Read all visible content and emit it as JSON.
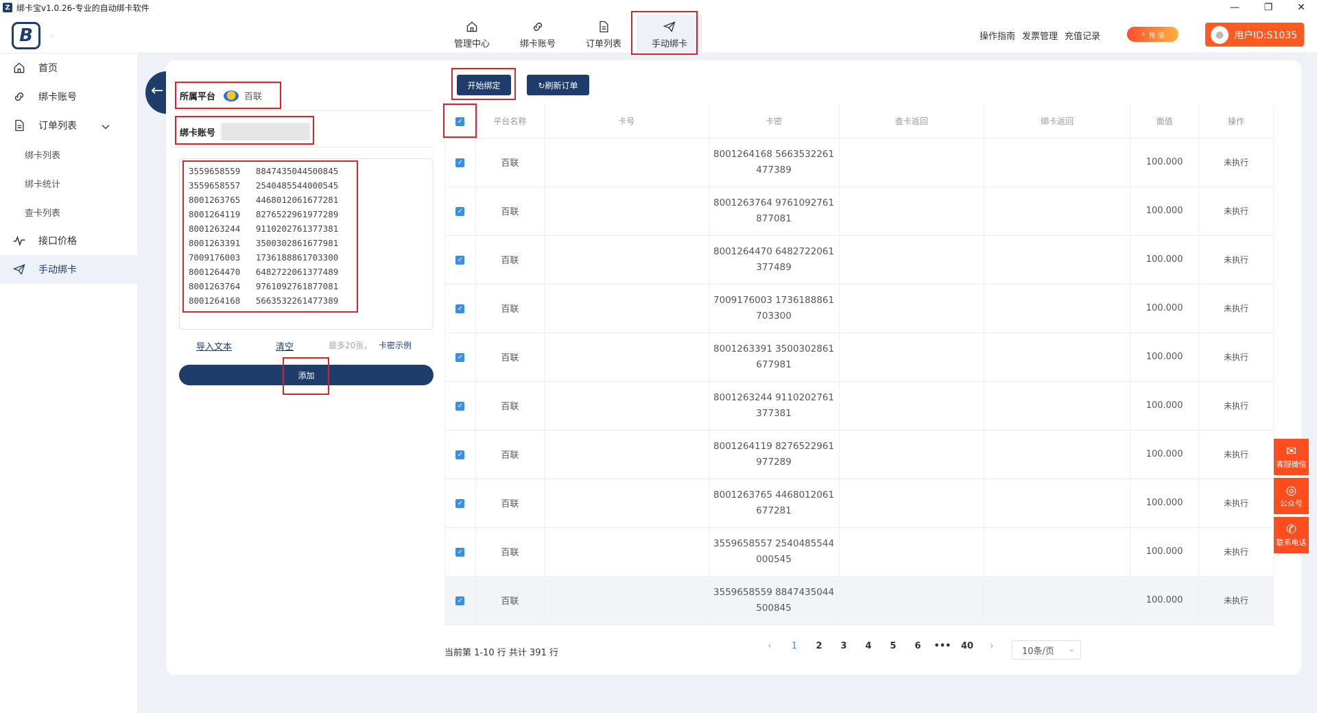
{
  "window": {
    "title": "绑卡宝v1.0.26-专业的自动绑卡软件",
    "app_icon": "Z",
    "minimize": "—",
    "restore": "❐",
    "close": "✕"
  },
  "header": {
    "logo_text": "B",
    "logo_dot": "·",
    "nav": [
      {
        "label": "管理中心",
        "icon": "home-icon"
      },
      {
        "label": "绑卡账号",
        "icon": "link-icon"
      },
      {
        "label": "订单列表",
        "icon": "document-icon"
      },
      {
        "label": "手动绑卡",
        "icon": "send-icon",
        "active": true
      }
    ],
    "links": [
      "操作指南",
      "发票管理",
      "充值记录"
    ],
    "recharge_label": "充 值",
    "recharge_bolt": "⚡",
    "user_label": "用户ID:S1035",
    "avatar_glyph": "●"
  },
  "sidebar": {
    "items": [
      {
        "label": "首页",
        "icon": "home-icon"
      },
      {
        "label": "绑卡账号",
        "icon": "link-icon"
      },
      {
        "label": "订单列表",
        "icon": "document-icon",
        "expanded": true
      },
      {
        "label": "绑卡列表"
      },
      {
        "label": "绑卡统计"
      },
      {
        "label": "查卡列表"
      },
      {
        "label": "接口价格",
        "icon": "pulse-icon"
      },
      {
        "label": "手动绑卡",
        "icon": "send-icon",
        "active": true
      }
    ]
  },
  "form": {
    "back_arrow": "←",
    "platform_label": "所属平台",
    "platform_value": "百联",
    "account_label": "绑卡账号",
    "card_lines": [
      "3559658559   8847435044500845",
      "3559658557   2540485544000545",
      "8001263765   4468012061677281",
      "8001264119   8276522961977289",
      "8001263244   9110202761377381",
      "8001263391   3500302861677981",
      "7009176003   1736188861703300",
      "8001264470   6482722061377489",
      "8001263764   9761092761877081",
      "8001264168   5663532261477389"
    ],
    "import_label": "导入文本",
    "clear_label": "清空",
    "limit_hint": "最多20张，",
    "example_label": "卡密示例",
    "add_label": "添加"
  },
  "actions": {
    "start_label": "开始绑定",
    "refresh_label": "↻刷新订单"
  },
  "table": {
    "headers": [
      "平台名称",
      "卡号",
      "卡密",
      "查卡返回",
      "绑卡返回",
      "面值",
      "操作"
    ],
    "check_mark": "✓",
    "rows": [
      {
        "platform": "百联",
        "card": "",
        "secret_l1": "8001264168 5663532261",
        "secret_l2": "477389",
        "query": "",
        "bind": "",
        "value": "100.000",
        "op": "未执行"
      },
      {
        "platform": "百联",
        "card": "",
        "secret_l1": "8001263764 9761092761",
        "secret_l2": "877081",
        "query": "",
        "bind": "",
        "value": "100.000",
        "op": "未执行"
      },
      {
        "platform": "百联",
        "card": "",
        "secret_l1": "8001264470 6482722061",
        "secret_l2": "377489",
        "query": "",
        "bind": "",
        "value": "100.000",
        "op": "未执行"
      },
      {
        "platform": "百联",
        "card": "",
        "secret_l1": "7009176003 1736188861",
        "secret_l2": "703300",
        "query": "",
        "bind": "",
        "value": "100.000",
        "op": "未执行"
      },
      {
        "platform": "百联",
        "card": "",
        "secret_l1": "8001263391 3500302861",
        "secret_l2": "677981",
        "query": "",
        "bind": "",
        "value": "100.000",
        "op": "未执行"
      },
      {
        "platform": "百联",
        "card": "",
        "secret_l1": "8001263244 9110202761",
        "secret_l2": "377381",
        "query": "",
        "bind": "",
        "value": "100.000",
        "op": "未执行"
      },
      {
        "platform": "百联",
        "card": "",
        "secret_l1": "8001264119 8276522961",
        "secret_l2": "977289",
        "query": "",
        "bind": "",
        "value": "100.000",
        "op": "未执行"
      },
      {
        "platform": "百联",
        "card": "",
        "secret_l1": "8001263765 4468012061",
        "secret_l2": "677281",
        "query": "",
        "bind": "",
        "value": "100.000",
        "op": "未执行"
      },
      {
        "platform": "百联",
        "card": "",
        "secret_l1": "3559658557 2540485544",
        "secret_l2": "000545",
        "query": "",
        "bind": "",
        "value": "100.000",
        "op": "未执行"
      },
      {
        "platform": "百联",
        "card": "",
        "secret_l1": "3559658559 8847435044",
        "secret_l2": "500845",
        "query": "",
        "bind": "",
        "value": "100.000",
        "op": "未执行"
      }
    ]
  },
  "pagination": {
    "info": "当前第 1-10 行  共计 391 行",
    "prev": "‹",
    "next": "›",
    "pages": [
      "1",
      "2",
      "3",
      "4",
      "5",
      "6",
      "•••",
      "40"
    ],
    "current": "1",
    "page_size": "10条/页",
    "page_size_caret": "⌄"
  },
  "float": {
    "wechat": "客服微信",
    "official": "公众号",
    "phone": "联系电话",
    "wechat_glyph": "✉",
    "official_glyph": "◎",
    "phone_glyph": "✆"
  }
}
